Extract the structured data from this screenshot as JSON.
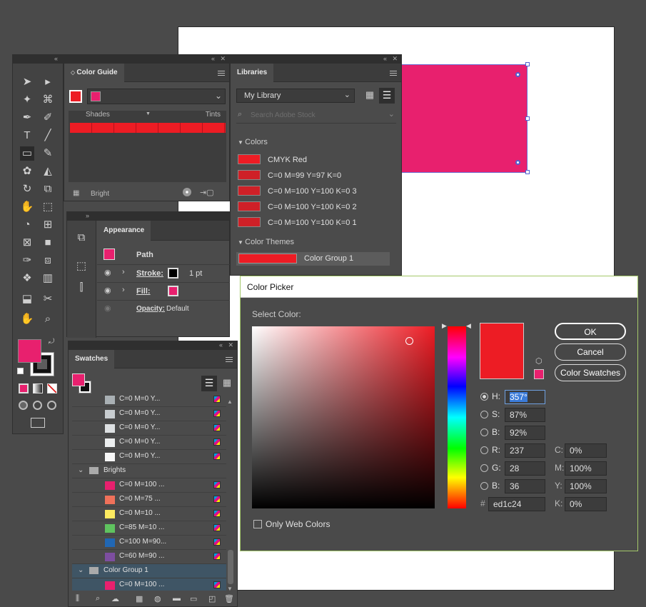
{
  "colors": {
    "magenta": "#e8206e",
    "red": "#ed1c24",
    "dark_red": "#cf2027",
    "panel": "#4b4b4b"
  },
  "tools_panel": {
    "icons": [
      "selection-icon",
      "direct-selection-icon",
      "magic-wand-icon",
      "lasso-icon",
      "pen-icon",
      "curvature-icon",
      "type-icon",
      "line-icon",
      "rectangle-icon",
      "paintbrush-icon",
      "shaper-icon",
      "eraser-icon",
      "rotate-icon",
      "scale-icon",
      "puppet-warp-icon",
      "free-transform-icon",
      "shape-builder-icon",
      "perspective-grid-icon",
      "mesh-icon",
      "gradient-icon",
      "eyedropper-icon",
      "blend-icon",
      "symbol-sprayer-icon",
      "column-graph-icon",
      "artboard-icon",
      "slice-icon",
      "hand-icon",
      "zoom-icon"
    ]
  },
  "color_guide": {
    "tab": "Color Guide",
    "shades": "Shades",
    "tints": "Tints",
    "footer": "Bright"
  },
  "appearance": {
    "tab": "Appearance",
    "path": "Path",
    "stroke_label": "Stroke:",
    "stroke_value": "1 pt",
    "fill_label": "Fill:",
    "opacity_label": "Opacity:",
    "opacity_value": "Default"
  },
  "swatches": {
    "tab": "Swatches",
    "rows": [
      {
        "label": "C=0 M=0 Y...",
        "color": "#a9b0b4"
      },
      {
        "label": "C=0 M=0 Y...",
        "color": "#c8cdd0"
      },
      {
        "label": "C=0 M=0 Y...",
        "color": "#dde0e2"
      },
      {
        "label": "C=0 M=0 Y...",
        "color": "#eceeef"
      },
      {
        "label": "C=0 M=0 Y...",
        "color": "#f7f7f7"
      },
      {
        "label": "Brights",
        "group": true
      },
      {
        "label": "C=0 M=100 ...",
        "color": "#e8206e"
      },
      {
        "label": "C=0 M=75 ...",
        "color": "#f0715a"
      },
      {
        "label": "C=0 M=10 ...",
        "color": "#fdea60"
      },
      {
        "label": "C=85 M=10 ...",
        "color": "#5fc35f"
      },
      {
        "label": "C=100 M=90...",
        "color": "#2167b3"
      },
      {
        "label": "C=60 M=90 ...",
        "color": "#7d4ea0"
      },
      {
        "label": "Color Group 1",
        "group": true,
        "selected": true
      },
      {
        "label": "C=0 M=100 ...",
        "color": "#e8206e",
        "selected": true
      }
    ]
  },
  "libraries": {
    "tab": "Libraries",
    "library": "My Library",
    "search_placeholder": "Search Adobe Stock",
    "colors_header": "Colors",
    "colors": [
      {
        "label": "CMYK Red",
        "color": "#ed1c24"
      },
      {
        "label": "C=0 M=99 Y=97 K=0",
        "color": "#cf2027"
      },
      {
        "label": "C=0 M=100 Y=100 K=0 3",
        "color": "#cf2027"
      },
      {
        "label": "C=0 M=100 Y=100 K=0 2",
        "color": "#cf2027"
      },
      {
        "label": "C=0 M=100 Y=100 K=0 1",
        "color": "#cf2027"
      }
    ],
    "themes_header": "Color Themes",
    "theme": "Color Group 1"
  },
  "color_picker": {
    "title": "Color Picker",
    "select_label": "Select Color:",
    "ok": "OK",
    "cancel": "Cancel",
    "swatches": "Color Swatches",
    "only_web": "Only Web Colors",
    "h_label": "H:",
    "h": "357°",
    "s_label": "S:",
    "s": "87%",
    "b_label": "B:",
    "b": "92%",
    "r_label": "R:",
    "r": "237",
    "g_label": "G:",
    "g": "28",
    "bl_label": "B:",
    "bl": "36",
    "hash": "#",
    "hex": "ed1c24",
    "c_label": "C:",
    "c": "0%",
    "m_label": "M:",
    "m": "100%",
    "y_label": "Y:",
    "y": "100%",
    "k_label": "K:",
    "k": "0%"
  }
}
